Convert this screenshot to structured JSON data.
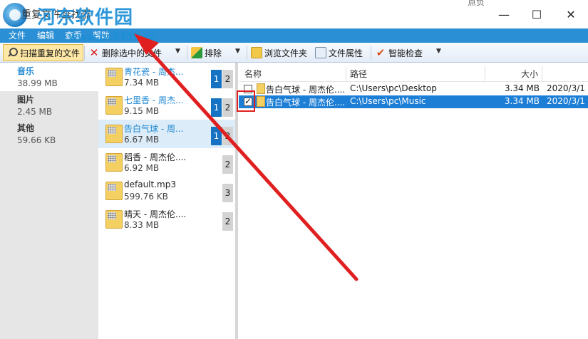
{
  "window": {
    "title": "重复文件查找器",
    "watermark": "河东软件园",
    "watermark_url": "www.pc0359.cn",
    "user_label": "点负"
  },
  "window_controls": {
    "minimize": "—",
    "maximize": "☐",
    "close": "✕"
  },
  "menu": [
    "文件",
    "编辑",
    "查看",
    "帮助"
  ],
  "toolbar": {
    "scan_label": "扫描重复的文件",
    "delete_label": "删除选中的文件",
    "exclude_label": "排除",
    "browse_label": "浏览文件夹",
    "props_label": "文件属性",
    "smart_label": "智能检查"
  },
  "categories": [
    {
      "name": "音乐",
      "size": "38.99 MB",
      "selected": true
    },
    {
      "name": "图片",
      "size": "2.45 MB",
      "selected": false
    },
    {
      "name": "其他",
      "size": "59.66 KB",
      "selected": false
    }
  ],
  "groups": [
    {
      "name": "青花瓷 - 周杰...",
      "size": "7.34 MB",
      "badge_a": "1",
      "badge_b": "2"
    },
    {
      "name": "七里香 - 周杰...",
      "size": "9.15 MB",
      "badge_a": "1",
      "badge_b": "2"
    },
    {
      "name": "告白气球 - 周...",
      "size": "6.67 MB",
      "badge_a": "1",
      "badge_b": "2"
    },
    {
      "name": "稻香 - 周杰伦....",
      "size": "6.92 MB",
      "badge_a": "",
      "badge_b": "2"
    },
    {
      "name": "default.mp3",
      "size": "599.76 KB",
      "badge_a": "",
      "badge_b": "3"
    },
    {
      "name": "晴天 - 周杰伦....",
      "size": "8.33 MB",
      "badge_a": "",
      "badge_b": "2"
    }
  ],
  "file_list": {
    "columns": {
      "name": "名称",
      "path": "路径",
      "size": "大小"
    },
    "rows": [
      {
        "name": "告白气球 - 周杰伦....",
        "path": "C:\\Users\\pc\\Desktop",
        "size": "3.34 MB",
        "date": "2020/3/1",
        "checked": false
      },
      {
        "name": "告白气球 - 周杰伦....",
        "path": "C:\\Users\\pc\\Music",
        "size": "3.34 MB",
        "date": "2020/3/1",
        "checked": true
      }
    ]
  },
  "colors": {
    "accent": "#1f87d0",
    "menubar": "#2a8fd4",
    "selection": "#1d7ed6",
    "annotation": "#e02020"
  }
}
